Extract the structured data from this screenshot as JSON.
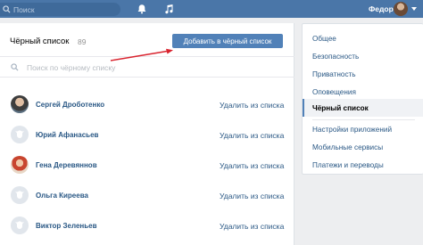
{
  "topbar": {
    "search_placeholder": "Поиск",
    "user_name": "Федор",
    "icons": [
      "search-icon",
      "bell-icon",
      "music-icon",
      "chevron-down-icon"
    ]
  },
  "blacklist": {
    "title": "Чёрный список",
    "count": "89",
    "add_button": "Добавить в чёрный список",
    "search_placeholder": "Поиск по чёрному списку",
    "remove_label": "Удалить из списка",
    "users": [
      {
        "name": "Сергей Дроботенко",
        "avatar": "photo"
      },
      {
        "name": "Юрий Афанасьев",
        "avatar": "default-avatar-icon"
      },
      {
        "name": "Гена Деревяннов",
        "avatar": "photo"
      },
      {
        "name": "Ольга Киреева",
        "avatar": "default-avatar-icon"
      },
      {
        "name": "Виктор Зеленьев",
        "avatar": "default-avatar-icon"
      }
    ]
  },
  "settings_menu": {
    "items": [
      {
        "label": "Общее"
      },
      {
        "label": "Безопасность"
      },
      {
        "label": "Приватность"
      },
      {
        "label": "Оповещения"
      },
      {
        "label": "Чёрный список",
        "active": true
      },
      {
        "label": "Настройки приложений"
      },
      {
        "label": "Мобильные сервисы"
      },
      {
        "label": "Платежи и переводы"
      }
    ]
  },
  "colors": {
    "header": "#4a76a8",
    "button": "#5181b8",
    "link": "#2a5885",
    "annotation_arrow": "#d9232e"
  }
}
